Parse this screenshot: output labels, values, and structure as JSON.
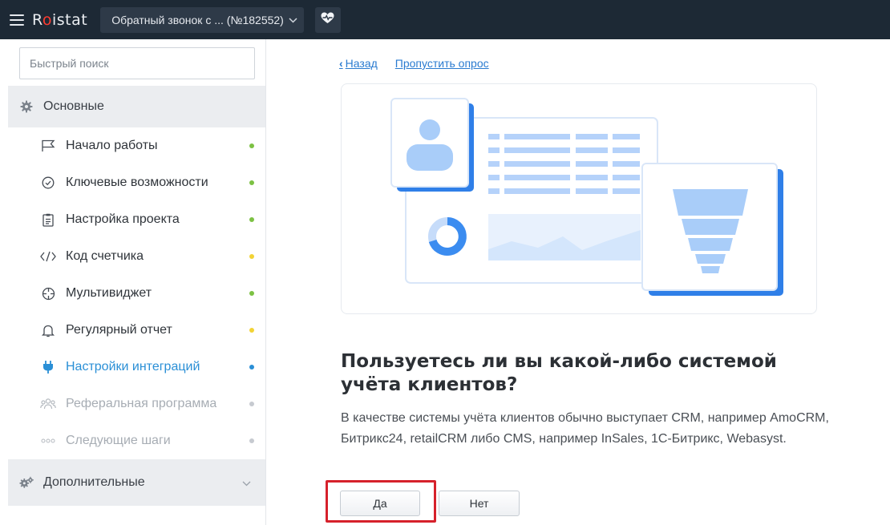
{
  "topbar": {
    "logo": {
      "prefix": "R",
      "accent": "o",
      "suffix": "istat"
    },
    "project": "Обратный звонок с ... (№182552)",
    "colors": {
      "bar": "#1d2935",
      "logo_accent": "#ff3b30"
    }
  },
  "sidebar": {
    "search": {
      "placeholder": "Быстрый поиск",
      "value": ""
    },
    "group_main": "Основные",
    "items": [
      {
        "label": "Начало работы",
        "icon": "flag-icon",
        "status": "#7cc143"
      },
      {
        "label": "Ключевые возможности",
        "icon": "check-circle-icon",
        "status": "#7cc143"
      },
      {
        "label": "Настройка проекта",
        "icon": "clipboard-icon",
        "status": "#7cc143"
      },
      {
        "label": "Код счетчика",
        "icon": "code-icon",
        "status": "#f2d335"
      },
      {
        "label": "Мультивиджет",
        "icon": "crosshair-icon",
        "status": "#7cc143"
      },
      {
        "label": "Регулярный отчет",
        "icon": "bell-icon",
        "status": "#f2d335"
      },
      {
        "label": "Настройки интеграций",
        "icon": "plug-icon",
        "status": "#2a8fd6"
      },
      {
        "label": "Реферальная программа",
        "icon": "users-icon",
        "status": "#c6cad0"
      },
      {
        "label": "Следующие шаги",
        "icon": "dots-icon",
        "status": "#c6cad0"
      }
    ],
    "group_extra": "Дополнительные"
  },
  "main": {
    "back_chevron": "‹",
    "back": "Назад",
    "skip": "Пропустить опрос",
    "question": "Пользуетесь ли вы какой-либо системой учёта клиентов?",
    "description": "В качестве системы учёта клиентов обычно выступает CRM, например AmoCRM, Битрикс24, retailCRM либо CMS, например InSales, 1С-Битрикс, Webasyst.",
    "yes": "Да",
    "no": "Нет",
    "colors": {
      "link": "#2a7bd0",
      "highlight": "#d6212b"
    }
  }
}
